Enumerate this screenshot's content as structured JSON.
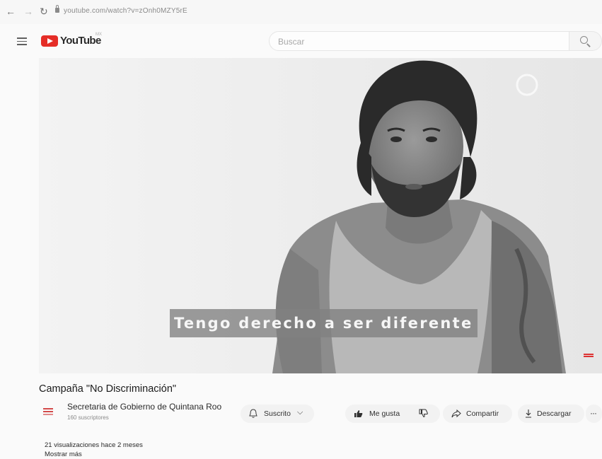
{
  "browser": {
    "url": "youtube.com/watch?v=zOnh0MZY5rE",
    "back_icon": "arrow-left",
    "forward_icon": "arrow-right",
    "reload_icon": "reload"
  },
  "header": {
    "logo_text": "YouTube",
    "logo_country": "MX",
    "search_placeholder": "Buscar",
    "brand_color": "#e52d27"
  },
  "video": {
    "caption": "Tengo derecho a ser diferente"
  },
  "info": {
    "title": "Campaña \"No Discriminación\"",
    "channel_name": "Secretaria de Gobierno de Quintana Roo",
    "subscribers": "160 suscriptores",
    "subscribe_label": "Suscrito",
    "like_label": "Me gusta",
    "share_label": "Compartir",
    "download_label": "Descargar",
    "more_label": "···",
    "views": "21 visualizaciones",
    "date": "hace 2 meses",
    "show_more": "Mostrar más"
  }
}
